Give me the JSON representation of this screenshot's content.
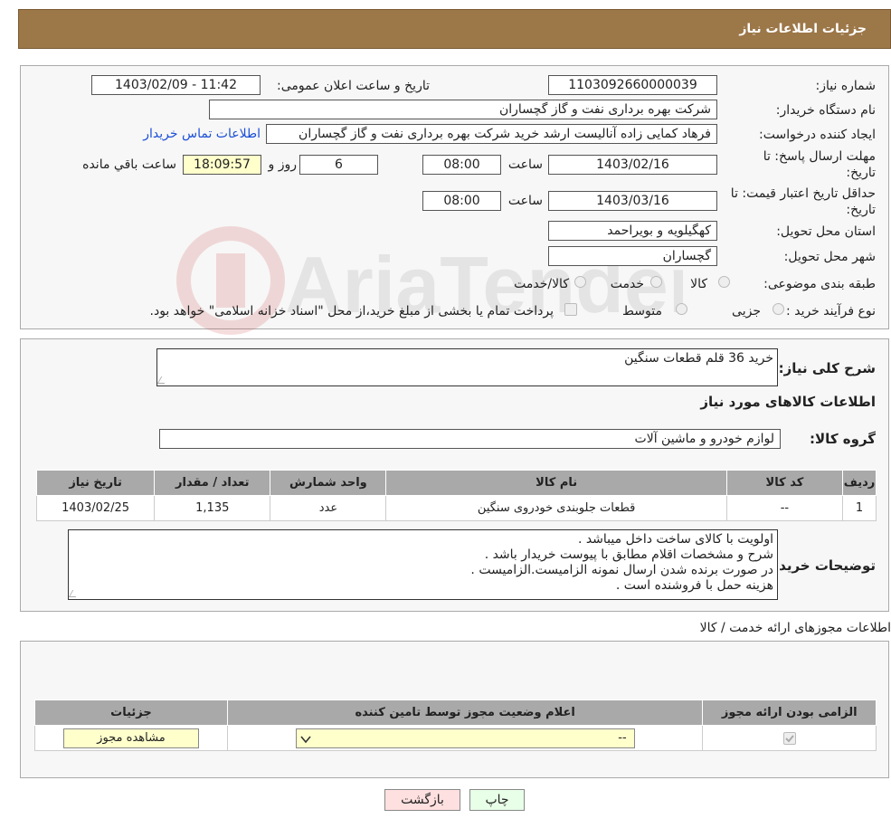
{
  "header": {
    "title": "جزئیات اطلاعات نیاز"
  },
  "details": {
    "need_number_label": "شماره نیاز:",
    "need_number": "1103092660000039",
    "announce_label": "تاریخ و ساعت اعلان عمومی:",
    "announce_value": "1403/02/09 - 11:42",
    "buyer_org_label": "نام دستگاه خریدار:",
    "buyer_org": "شرکت بهره برداری نفت و گاز گچساران",
    "creator_label": "ایجاد کننده درخواست:",
    "creator": "فرهاد کمایی زاده آنالیست ارشد خرید شرکت بهره برداری نفت و گاز گچساران",
    "contact_link": "اطلاعات تماس خریدار",
    "deadline_label": "مهلت ارسال پاسخ: تا تاریخ:",
    "deadline_date": "1403/02/16",
    "time_label": "ساعت",
    "deadline_time": "08:00",
    "days_value": "6",
    "days_label": "روز و",
    "remaining_time": "18:09:57",
    "remaining_label": "ساعت باقي مانده",
    "validity_label": "حداقل تاریخ اعتبار قیمت: تا تاریخ:",
    "validity_date": "1403/03/16",
    "validity_time": "08:00",
    "province_label": "استان محل تحویل:",
    "province": "کهگیلویه و بویراحمد",
    "city_label": "شهر محل تحویل:",
    "city": "گچساران",
    "category_label": "طبقه بندی موضوعی:",
    "category_options": [
      "کالا",
      "خدمت",
      "کالا/خدمت"
    ],
    "process_label": "نوع فرآیند خرید :",
    "process_options": [
      "جزیی",
      "متوسط"
    ],
    "payment_note": "پرداخت تمام یا بخشی از مبلغ خرید،از محل \"اسناد خزانه اسلامی\" خواهد بود."
  },
  "watermark": {
    "text": "AriaTender.neT"
  },
  "goods": {
    "summary_label": "شرح کلی نیاز:",
    "summary": "خرید 36 قلم قطعات سنگین",
    "section_title": "اطلاعات کالاهای مورد نیاز",
    "group_label": "گروه کالا:",
    "group": "لوازم خودرو و ماشین آلات",
    "columns": [
      "ردیف",
      "کد کالا",
      "نام کالا",
      "واحد شمارش",
      "تعداد / مقدار",
      "تاریخ نیاز"
    ],
    "rows": [
      {
        "row": "1",
        "code": "--",
        "name": "قطعات جلوبندی خودروی سنگین",
        "unit": "عدد",
        "qty": "1,135",
        "date": "1403/02/25"
      }
    ],
    "notes_label": "توضیحات خریدار:",
    "notes": [
      "اولویت با کالای ساخت داخل میباشد .",
      "شرح و مشخصات اقلام مطابق با پیوست خریدار باشد .",
      "در صورت برنده شدن ارسال نمونه الزامیست.الزامیست .",
      "هزینه حمل با فروشنده است ."
    ]
  },
  "licenses": {
    "title": "اطلاعات مجوزهای ارائه خدمت / کالا",
    "columns": [
      "الزامی بودن ارائه مجوز",
      "اعلام وضعیت مجوز توسط تامین کننده",
      "جزئیات"
    ],
    "select_value": "--",
    "view_button": "مشاهده مجوز"
  },
  "actions": {
    "print": "چاپ",
    "back": "بازگشت"
  }
}
